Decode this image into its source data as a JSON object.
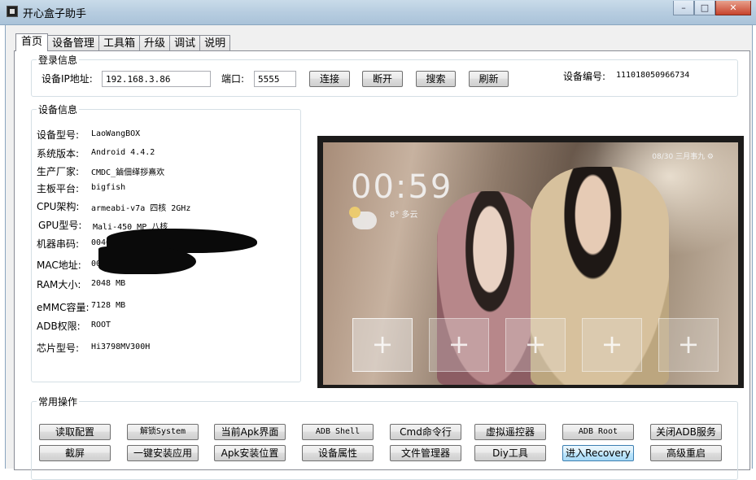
{
  "window": {
    "title": "开心盒子助手",
    "min": "–",
    "max": "□",
    "close": "✕",
    "icon": "app-icon"
  },
  "tabs": [
    "首页",
    "设备管理",
    "工具箱",
    "升级",
    "调试",
    "说明"
  ],
  "login": {
    "group_title": "登录信息",
    "ip_label": "设备IP地址:",
    "ip_value": "192.168.3.86",
    "port_label": "端口:",
    "port_value": "5555",
    "connect": "连接",
    "disconnect": "断开",
    "search": "搜索",
    "refresh": "刷新",
    "device_id_label": "设备编号:",
    "device_id_value": "111018050966734"
  },
  "device": {
    "group_title": "设备信息",
    "rows": [
      {
        "label": "设备型号:",
        "value": "LaoWangBOX"
      },
      {
        "label": "系统版本:",
        "value": "Android 4.4.2"
      },
      {
        "label": "生产厂家:",
        "value": "CMDC_鏀佃缂拶熹欢"
      },
      {
        "label": "主板平台:",
        "value": "bigfish"
      },
      {
        "label": "CPU架构:",
        "value": "armeabi-v7a 四核 2GHz"
      },
      {
        "label": "GPU型号:",
        "value": "Mali-450 MP 八核"
      },
      {
        "label": "机器串码:",
        "value": "0046"
      },
      {
        "label": "MAC地址:",
        "value": "00"
      },
      {
        "label": "RAM大小:",
        "value": "2048 MB"
      },
      {
        "label": "eMMC容量:",
        "value": "7128 MB"
      },
      {
        "label": "ADB权限:",
        "value": "ROOT"
      },
      {
        "label": "芯片型号:",
        "value": "Hi3798MV300H"
      }
    ]
  },
  "screen": {
    "clock": "00:59",
    "temp": "8°  多云",
    "status": "08/30  三月事九  ⚙",
    "tile_glyph": "+"
  },
  "ops": {
    "group_title": "常用操作",
    "row1": [
      "读取配置",
      "解锁System",
      "当前Apk界面",
      "ADB Shell",
      "Cmd命令行",
      "虚拟遥控器",
      "ADB  Root",
      "关闭ADB服务"
    ],
    "row2": [
      "截屏",
      "一键安装应用",
      "Apk安装位置",
      "设备属性",
      "文件管理器",
      "Diy工具",
      "进入Recovery",
      "高级重启"
    ]
  }
}
